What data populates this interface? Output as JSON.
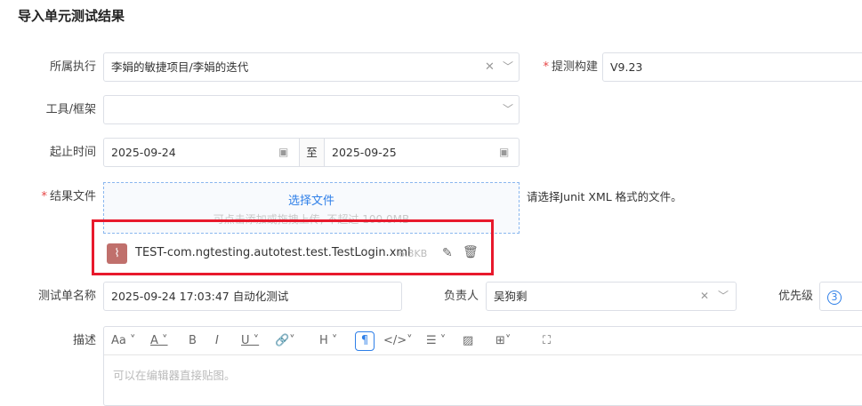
{
  "title": "导入单元测试结果",
  "fields": {
    "execution": {
      "label": "所属执行",
      "value": "李娟的敏捷项目/李娟的迭代"
    },
    "build": {
      "label": "提测构建",
      "value": "V9.23"
    },
    "tool": {
      "label": "工具/框架",
      "value": ""
    },
    "dates": {
      "label": "起止时间",
      "start": "2025-09-24",
      "sep": "至",
      "end": "2025-09-25"
    },
    "file": {
      "label": "结果文件",
      "select": "选择文件",
      "hint": "可点击添加或拖拽上传, 不超过 100.0MB",
      "note": "请选择Junit XML 格式的文件。",
      "name": "TEST-com.ngtesting.autotest.test.TestLogin.xml",
      "size": "6.3KB"
    },
    "name": {
      "label": "测试单名称",
      "value": "2025-09-24 17:03:47 自动化测试"
    },
    "owner": {
      "label": "负责人",
      "value": "吴狗剩"
    },
    "priority": {
      "label": "优先级",
      "value": "3"
    },
    "desc": {
      "label": "描述",
      "placeholder": "可以在编辑器直接贴图。"
    }
  },
  "required_mark": "*",
  "icons": {
    "clear": "✕",
    "chevron": "⌄",
    "calendar": "📅"
  },
  "colors": {
    "accent": "#2e7fe8",
    "highlight": "#e8192c",
    "file_icon": "#c0706c"
  }
}
